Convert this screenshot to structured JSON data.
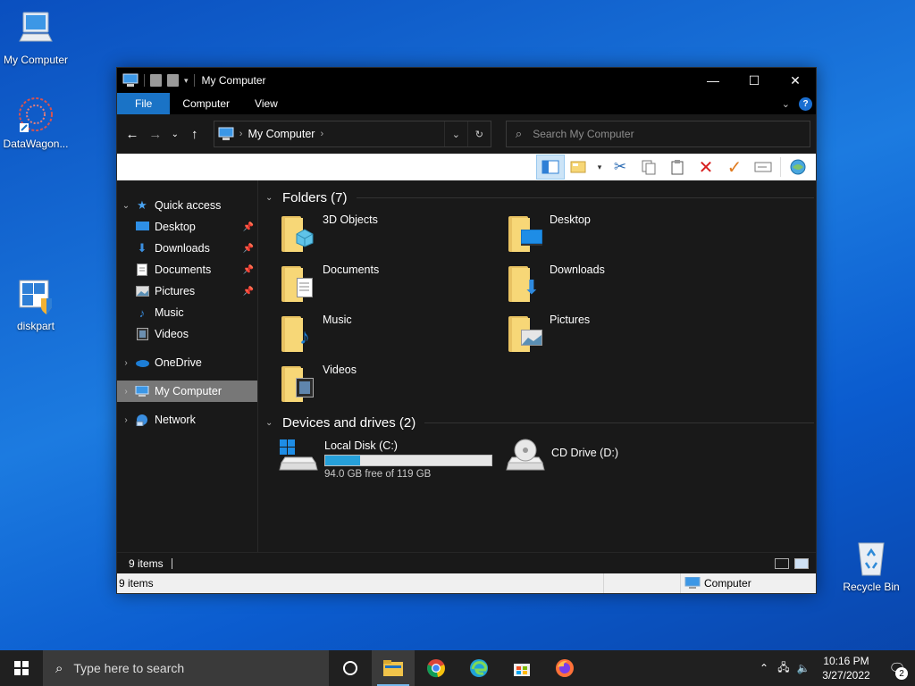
{
  "desktop": {
    "icons": [
      {
        "label": "My Computer",
        "icon": "computer-icon"
      },
      {
        "label": "DataWagon...",
        "icon": "datawagon-shortcut-icon"
      },
      {
        "label": "diskpart",
        "icon": "diskpart-shield-icon"
      },
      {
        "label": "Recycle Bin",
        "icon": "recycle-bin-icon"
      }
    ]
  },
  "window": {
    "title": "My Computer",
    "controls": {
      "minimize": "—",
      "maximize": "☐",
      "close": "✕"
    },
    "ribbon_tabs": [
      "File",
      "Computer",
      "View"
    ],
    "help": "?",
    "address": {
      "crumb": "My Computer",
      "separator": "›"
    },
    "search_placeholder": "Search My Computer",
    "sidebar": {
      "items": [
        {
          "label": "Quick access",
          "icon": "star-icon",
          "pinned": false
        },
        {
          "label": "Desktop",
          "icon": "desktop-icon",
          "pinned": true
        },
        {
          "label": "Downloads",
          "icon": "download-icon",
          "pinned": true
        },
        {
          "label": "Documents",
          "icon": "document-icon",
          "pinned": true
        },
        {
          "label": "Pictures",
          "icon": "pictures-icon",
          "pinned": true
        },
        {
          "label": "Music",
          "icon": "music-icon",
          "pinned": false
        },
        {
          "label": "Videos",
          "icon": "videos-icon",
          "pinned": false
        },
        {
          "label": "OneDrive",
          "icon": "cloud-icon",
          "pinned": false
        },
        {
          "label": "My Computer",
          "icon": "computer-icon",
          "pinned": false,
          "selected": true
        },
        {
          "label": "Network",
          "icon": "network-icon",
          "pinned": false
        }
      ]
    },
    "folders_header": "Folders (7)",
    "folders": [
      {
        "name": "3D Objects",
        "icon": "3d-objects-icon"
      },
      {
        "name": "Desktop",
        "icon": "desktop-icon"
      },
      {
        "name": "Documents",
        "icon": "document-icon"
      },
      {
        "name": "Downloads",
        "icon": "download-icon"
      },
      {
        "name": "Music",
        "icon": "music-icon"
      },
      {
        "name": "Pictures",
        "icon": "pictures-icon"
      },
      {
        "name": "Videos",
        "icon": "videos-icon"
      }
    ],
    "drives_header": "Devices and drives (2)",
    "drives": [
      {
        "name": "Local Disk (C:)",
        "free_text": "94.0 GB free of 119 GB",
        "used_fraction": 0.21,
        "icon": "windows-drive-icon"
      },
      {
        "name": "CD Drive (D:)",
        "icon": "cd-drive-icon"
      }
    ],
    "status": {
      "items": "9 items",
      "items2": "9 items",
      "location": "Computer"
    }
  },
  "taskbar": {
    "search_placeholder": "Type here to search",
    "time": "10:16 PM",
    "date": "3/27/2022",
    "notification_count": "2"
  },
  "colors": {
    "accent": "#1a73c6",
    "drive_bar": "#26a0da",
    "desktop_bg": "#0b5ccf"
  }
}
